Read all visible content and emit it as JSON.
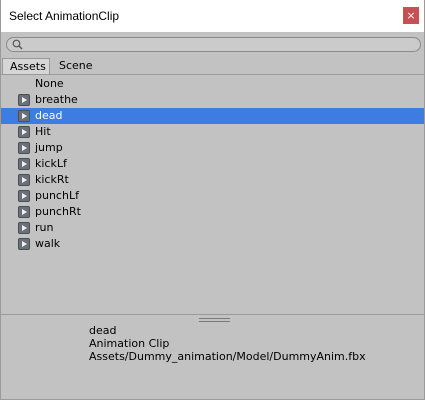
{
  "window": {
    "title": "Select AnimationClip",
    "close_glyph": "×"
  },
  "search": {
    "value": "",
    "placeholder": ""
  },
  "tabs": [
    {
      "label": "Assets",
      "active": true
    },
    {
      "label": "Scene",
      "active": false
    }
  ],
  "list": {
    "none_label": "None",
    "items": [
      {
        "label": "breathe",
        "icon": "animation-clip-icon",
        "selected": false
      },
      {
        "label": "dead",
        "icon": "animation-clip-icon",
        "selected": true
      },
      {
        "label": "Hit",
        "icon": "animation-clip-icon",
        "selected": false
      },
      {
        "label": "jump",
        "icon": "animation-clip-icon",
        "selected": false
      },
      {
        "label": "kickLf",
        "icon": "animation-clip-icon",
        "selected": false
      },
      {
        "label": "kickRt",
        "icon": "animation-clip-icon",
        "selected": false
      },
      {
        "label": "punchLf",
        "icon": "animation-clip-icon",
        "selected": false
      },
      {
        "label": "punchRt",
        "icon": "animation-clip-icon",
        "selected": false
      },
      {
        "label": "run",
        "icon": "animation-clip-icon",
        "selected": false
      },
      {
        "label": "walk",
        "icon": "animation-clip-icon",
        "selected": false
      }
    ]
  },
  "preview": {
    "name": "dead",
    "type": "Animation Clip",
    "path": "Assets/Dummy_animation/Model/DummyAnim.fbx"
  },
  "colors": {
    "selection": "#3d7ce0",
    "close_button": "#c75050",
    "panel_background": "#c2c2c2"
  }
}
